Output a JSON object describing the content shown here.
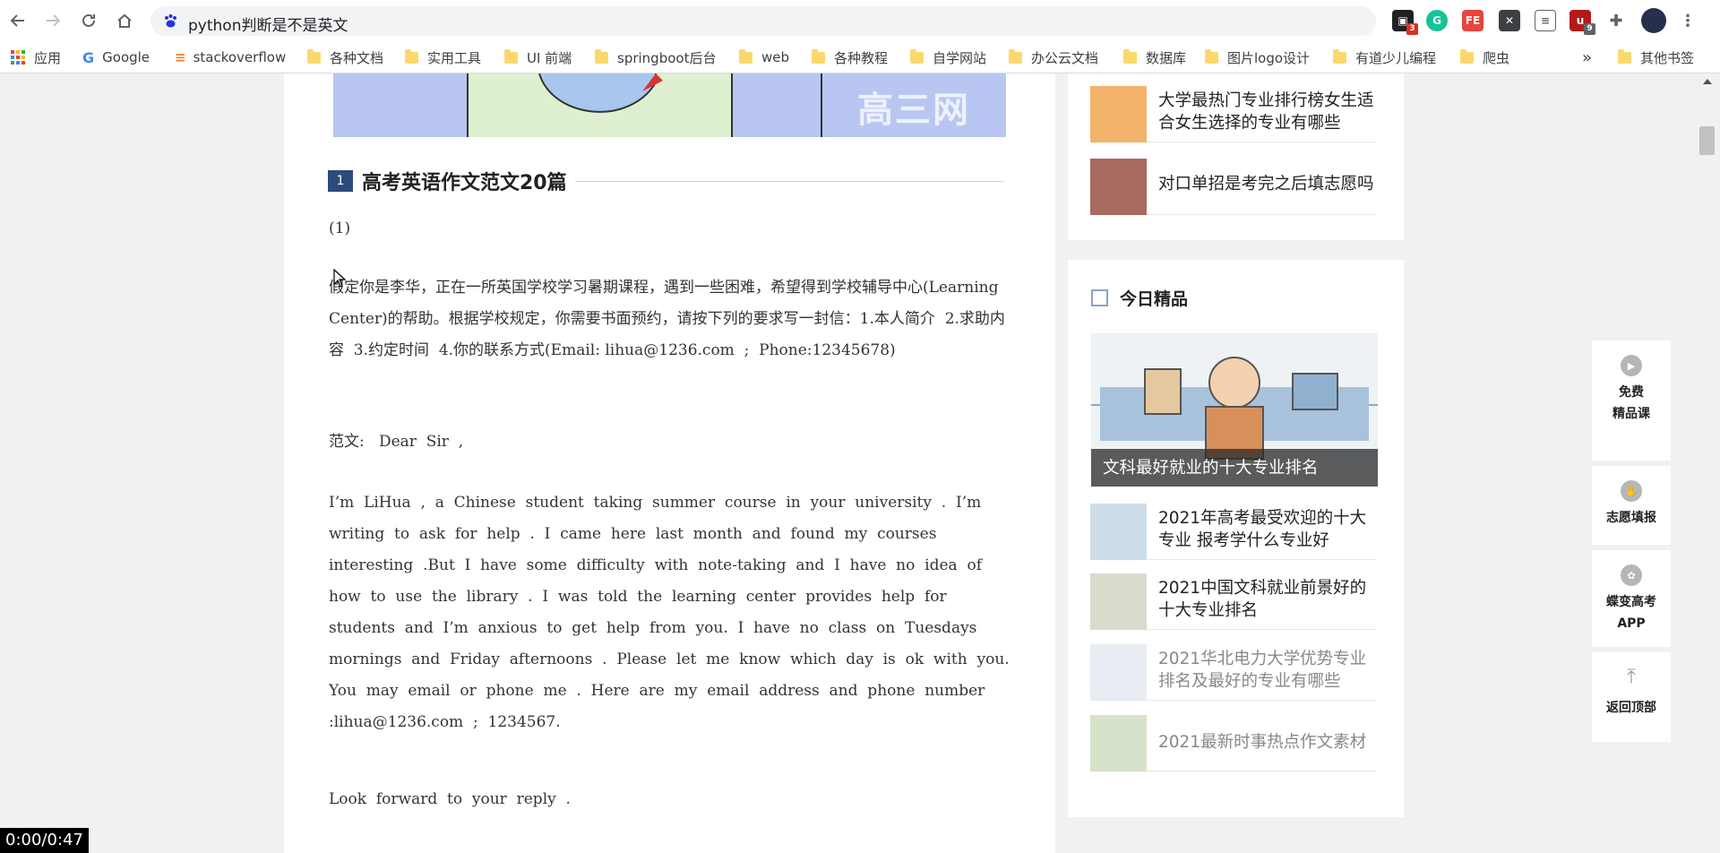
{
  "browser": {
    "url": "python判断是不是英文",
    "extension_badges": [
      "3",
      "9"
    ]
  },
  "bookmarks": {
    "items": [
      "应用",
      "Google",
      "stackoverflow",
      "各种文档",
      "实用工具",
      "UI 前端",
      "springboot后台",
      "web",
      "各种教程",
      "自学网站",
      "办公云文档",
      "数据库",
      "图片logo设计",
      "有道少儿编程",
      "爬虫"
    ],
    "more": "»",
    "other": "其他书签"
  },
  "article": {
    "hero_watermark": "高三网",
    "section_num": "1",
    "section_title": "高考英语作文范文20篇",
    "paragraphs": [
      "(1)",
      "假定你是李华，正在一所英国学校学习暑期课程，遇到一些困难，希望得到学校辅导中心(Learning  Center)的帮助。根据学校规定，你需要书面预约，请按下列的要求写一封信：1.本人简介  2.求助内容  3.约定时间  4.你的联系方式(Email: lihua@1236.com  ;  Phone:12345678)",
      "范文:   Dear  Sir  ,",
      "I’m  LiHua  ,  a  Chinese  student  taking  summer  course  in  your  university  .  I’m  writing  to  ask  for  help  .  I  came  here  last  month  and  found  my  courses  interesting  .But  I  have  some  difficulty  with  note-taking  and  I  have  no  idea  of  how  to  use  the  library  .  I  was  told  the  learning  center  provides  help  for  students  and  I’m  anxious  to  get  help  from  you.  I  have  no  class  on  Tuesdays  mornings  and  Friday  afternoons  .  Please  let  me  know  which  day  is  ok  with  you.  You  may  email  or  phone  me  .  Here  are  my  email  address  and  phone  number  :lihua@1236.com  ;  1234567.",
      "Look  forward  to  your  reply  ."
    ]
  },
  "sidebar_top": {
    "items": [
      {
        "title": "大学最热门专业排行榜女生适合女生选择的专业有哪些"
      },
      {
        "title": "对口单招是考完之后填志愿吗"
      }
    ]
  },
  "sidebar_featured": {
    "heading": "今日精品",
    "banner_caption": "文科最好就业的十大专业排名",
    "items": [
      {
        "title": "2021年高考最受欢迎的十大专业 报考学什么专业好"
      },
      {
        "title": "2021中国文科就业前景好的十大专业排名"
      },
      {
        "title": "2021华北电力大学优势专业排名及最好的专业有哪些"
      },
      {
        "title": "2021最新时事热点作文素材"
      }
    ]
  },
  "float_panel": {
    "buttons": [
      "免费\n精品课",
      "志愿填报",
      "蝶变高考\nAPP",
      "返回顶部"
    ]
  },
  "video": {
    "time": "0:00/0:47"
  }
}
